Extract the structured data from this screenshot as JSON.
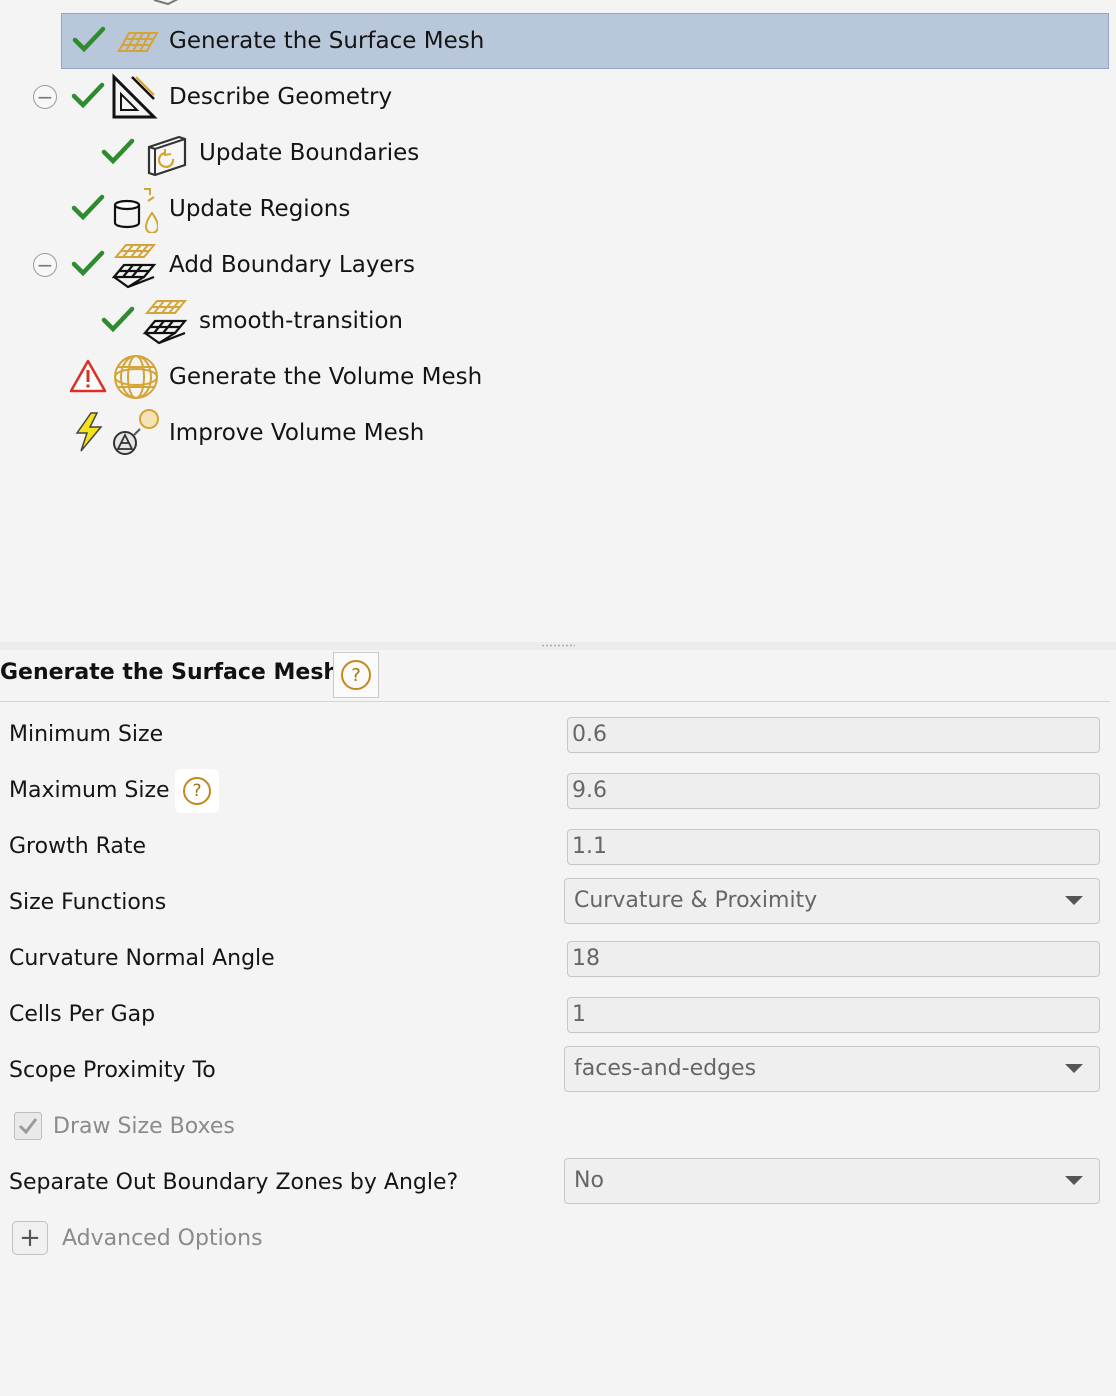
{
  "tree": {
    "items": [
      {
        "label": "Generate the Surface Mesh",
        "status": "done",
        "icon": "surface-mesh-icon",
        "selected": true
      },
      {
        "label": "Describe Geometry",
        "status": "done",
        "icon": "geometry-icon",
        "collapsible": true
      },
      {
        "label": "Update Boundaries",
        "status": "done",
        "icon": "boundaries-icon"
      },
      {
        "label": "Update Regions",
        "status": "done",
        "icon": "regions-icon"
      },
      {
        "label": "Add Boundary Layers",
        "status": "done",
        "icon": "boundary-layers-icon",
        "collapsible": true
      },
      {
        "label": "smooth-transition",
        "status": "done",
        "icon": "boundary-layers-icon"
      },
      {
        "label": "Generate the Volume Mesh",
        "status": "warning",
        "icon": "volume-mesh-icon"
      },
      {
        "label": "Improve Volume Mesh",
        "status": "pending",
        "icon": "improve-mesh-icon"
      }
    ],
    "collapse_glyph": "−"
  },
  "panel": {
    "title": "Generate the Surface Mesh",
    "help_glyph": "?",
    "fields": {
      "minimum_size": {
        "label": "Minimum Size",
        "value": "0.6"
      },
      "maximum_size": {
        "label": "Maximum Size",
        "value": "9.6"
      },
      "growth_rate": {
        "label": "Growth Rate",
        "value": "1.1"
      },
      "size_functions": {
        "label": "Size Functions",
        "value": "Curvature & Proximity"
      },
      "curvature_normal_angle": {
        "label": "Curvature Normal Angle",
        "value": "18"
      },
      "cells_per_gap": {
        "label": "Cells Per Gap",
        "value": "1"
      },
      "scope_proximity_to": {
        "label": "Scope Proximity To",
        "value": "faces-and-edges"
      },
      "draw_size_boxes": {
        "label": "Draw Size Boxes",
        "checked": true
      },
      "separate_boundary_zones": {
        "label": "Separate Out Boundary Zones by Angle?",
        "value": "No"
      }
    },
    "advanced_options": {
      "label": "Advanced Options",
      "glyph": "+"
    }
  },
  "colors": {
    "selection": "#b8c7da",
    "check_green": "#2e8b2e",
    "warning_red": "#d93025",
    "mesh_gold": "#d4a437",
    "help_gold": "#c28a1e"
  }
}
